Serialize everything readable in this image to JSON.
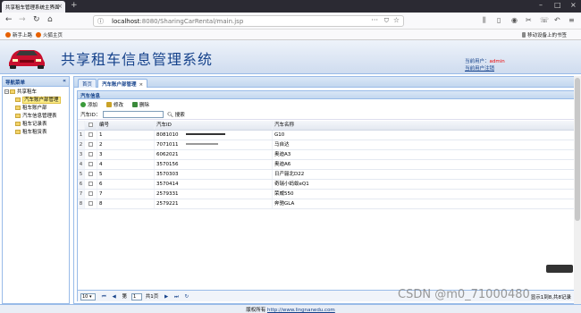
{
  "browser": {
    "tab_title": "共享租车管理系统主界面",
    "url_host": "localhost",
    "url_path": ":8080/SharingCarRental/main.jsp",
    "bookmarks": [
      "新手上路",
      "火狐主页"
    ],
    "mobile_bookmarks": "移动设备上的书签"
  },
  "header": {
    "title": "共享租车信息管理系统",
    "user_label": "当前用户：",
    "user_name": "admin",
    "logout": "当前用户注销"
  },
  "sidebar": {
    "title": "导航菜单",
    "collapse_icon": "«",
    "root": "共享租车",
    "items": [
      {
        "label": "汽车账户部管理",
        "selected": true
      },
      {
        "label": "租车账户部",
        "selected": false
      },
      {
        "label": "汽车信息管理表",
        "selected": false
      },
      {
        "label": "租车记录表",
        "selected": false
      },
      {
        "label": "租车租赁表",
        "selected": false
      }
    ]
  },
  "tabs": [
    {
      "label": "首页",
      "active": false
    },
    {
      "label": "汽车账户部管理",
      "active": true
    }
  ],
  "panel": {
    "title": "汽车信息",
    "add": "添加",
    "edit": "修改",
    "delete": "删除",
    "search_label": "汽车ID：",
    "search_placeholder": "",
    "search_button": "搜索"
  },
  "grid": {
    "columns": [
      "编号",
      "汽车ID",
      "汽车名称"
    ],
    "rows": [
      {
        "n": "1",
        "num": "1",
        "id": "8081010",
        "name": "G10"
      },
      {
        "n": "2",
        "num": "2",
        "id": "7071011",
        "name": "马自达"
      },
      {
        "n": "3",
        "num": "3",
        "id": "6062021",
        "name": "奥迪A3"
      },
      {
        "n": "4",
        "num": "4",
        "id": "3570156",
        "name": "奥迪A6"
      },
      {
        "n": "5",
        "num": "5",
        "id": "3570303",
        "name": "日产骊北D22"
      },
      {
        "n": "6",
        "num": "6",
        "id": "3570414",
        "name": "奇瑞小蚂蚁eQ1"
      },
      {
        "n": "7",
        "num": "7",
        "id": "2579331",
        "name": "荣威550"
      },
      {
        "n": "8",
        "num": "8",
        "id": "2579221",
        "name": "奔驰GLA"
      }
    ]
  },
  "pager": {
    "page_size": "10",
    "page_label": "第",
    "page_value": "1",
    "total_pages": "共1页",
    "info": "显示1到8,共8记录"
  },
  "footer": {
    "prefix": "版权所有",
    "link": "http://www.lingnanedu.com"
  },
  "watermark": "CSDN @m0_71000480"
}
